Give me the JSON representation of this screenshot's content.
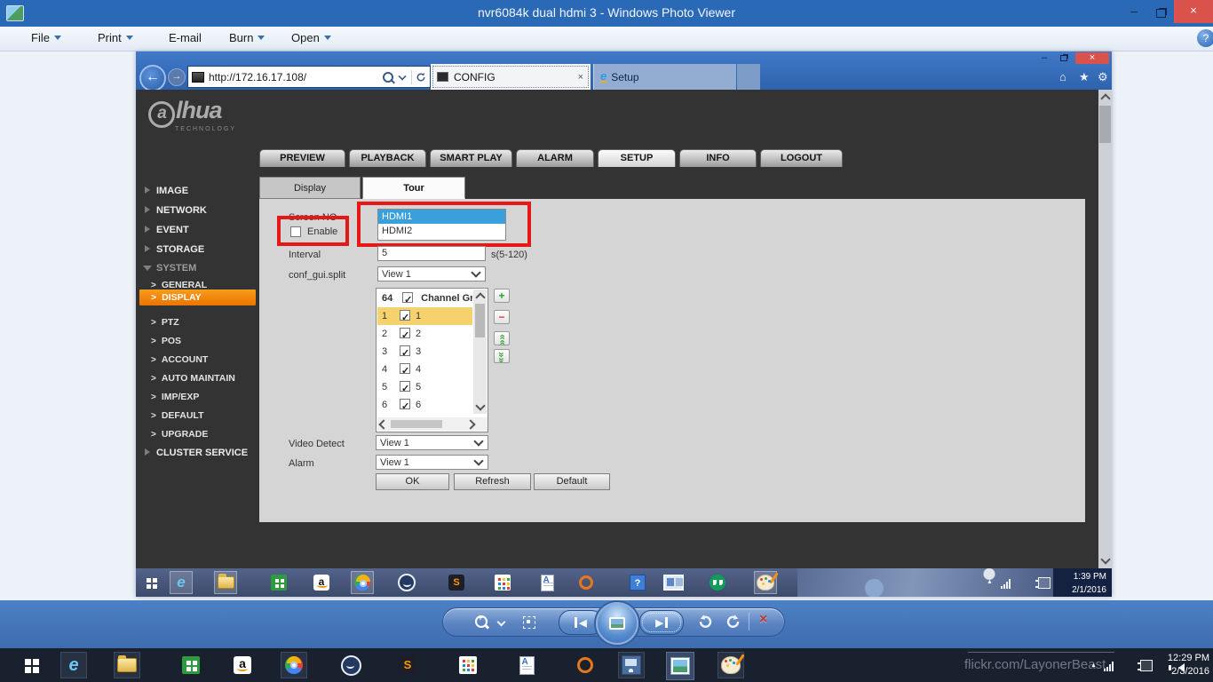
{
  "window": {
    "title": "nvr6084k dual hdmi 3 - Windows Photo Viewer",
    "menu": {
      "file": "File",
      "print": "Print",
      "email": "E-mail",
      "burn": "Burn",
      "open": "Open"
    },
    "help_glyph": "?"
  },
  "browser": {
    "url": "http://172.16.17.108/",
    "tab_config": "CONFIG",
    "tab_setup": "Setup"
  },
  "nvr": {
    "brand": {
      "logo_first": "a",
      "logo_rest": "lhua",
      "tagline": "TECHNOLOGY"
    },
    "nav": {
      "preview": "PREVIEW",
      "playback": "PLAYBACK",
      "smartplay": "SMART PLAY",
      "alarm": "ALARM",
      "setup": "SETUP",
      "info": "INFO",
      "logout": "LOGOUT"
    },
    "sidebar": {
      "image": "IMAGE",
      "network": "NETWORK",
      "event": "EVENT",
      "storage": "STORAGE",
      "system": "SYSTEM",
      "general": "GENERAL",
      "display": "DISPLAY",
      "ptz": "PTZ",
      "pos": "POS",
      "account": "ACCOUNT",
      "auto_maintain": "AUTO MAINTAIN",
      "imp_exp": "IMP/EXP",
      "default": "DEFAULT",
      "upgrade": "UPGRADE",
      "cluster": "CLUSTER SERVICE"
    },
    "tour": {
      "tab_display": "Display",
      "tab_tour": "Tour",
      "screen_label": "Screen NO",
      "screen_option1": "HDMI1",
      "screen_option2": "HDMI2",
      "screen_selected": "HDMI1",
      "enable_label": "Enable",
      "enable_checked": false,
      "interval_label": "Interval",
      "interval_value": "5",
      "interval_hint": "s(5-120)",
      "split_label": "conf_gui.split",
      "split_value": "View 1",
      "channels": {
        "header_count": "64",
        "header_label": "Channel Group",
        "all_checked": true,
        "selected_row": "1",
        "rows": [
          {
            "num": "1",
            "label": "1",
            "checked": true
          },
          {
            "num": "2",
            "label": "2",
            "checked": true
          },
          {
            "num": "3",
            "label": "3",
            "checked": true
          },
          {
            "num": "4",
            "label": "4",
            "checked": true
          },
          {
            "num": "5",
            "label": "5",
            "checked": true
          },
          {
            "num": "6",
            "label": "6",
            "checked": true
          }
        ]
      },
      "video_detect_label": "Video Detect",
      "video_detect_value": "View 1",
      "alarm_label": "Alarm",
      "alarm_value": "View 1",
      "ok": "OK",
      "refresh": "Refresh",
      "default_btn": "Default"
    }
  },
  "inner_desktop": {
    "clock_time": "1:39 PM",
    "clock_date": "2/1/2016"
  },
  "taskbar": {
    "watermark": "flickr.com/LayonerBeast",
    "clock_time": "12:29 PM",
    "clock_date": "2/3/2016"
  },
  "glyphs": {
    "close": "×",
    "minimize": "–",
    "back": "←",
    "forward": "→",
    "home": "⌂",
    "favorites": "★",
    "tools": "⚙",
    "ie": "e",
    "amazon": "a",
    "sublime": "S",
    "help": "?",
    "doc": "A",
    "prev": "◀",
    "next": "▶",
    "add": "+",
    "remove": "−",
    "chev_up_dbl": "««",
    "tray_up": "▲"
  },
  "colors": {
    "annotation_red": "#e51717",
    "accent_orange": "#ef8200",
    "selection_blue": "#3aa0dc",
    "highlight_yellow": "#f6d26e",
    "titlebar_blue": "#2a69b5",
    "ie_blue": "#3a74c4"
  },
  "icon_names": {
    "viewer_controls": [
      "zoom",
      "actual-size",
      "previous",
      "slideshow",
      "next",
      "rotate-left",
      "rotate-right",
      "delete"
    ],
    "taskbar_apps": [
      "start",
      "internet-explorer",
      "file-explorer",
      "windows-store",
      "amazon",
      "chrome",
      "hipchat",
      "sublime-text",
      "app-grid",
      "word-viewer",
      "orange-ring-app",
      "remote-desktop",
      "photo-viewer",
      "paint"
    ],
    "inner_taskbar_apps": [
      "start",
      "internet-explorer",
      "file-explorer",
      "windows-store",
      "amazon",
      "chrome",
      "hipchat",
      "sublime-text",
      "app-grid",
      "word-viewer",
      "orange-ring-app",
      "help-app",
      "window-app",
      "hangouts",
      "paint"
    ]
  }
}
